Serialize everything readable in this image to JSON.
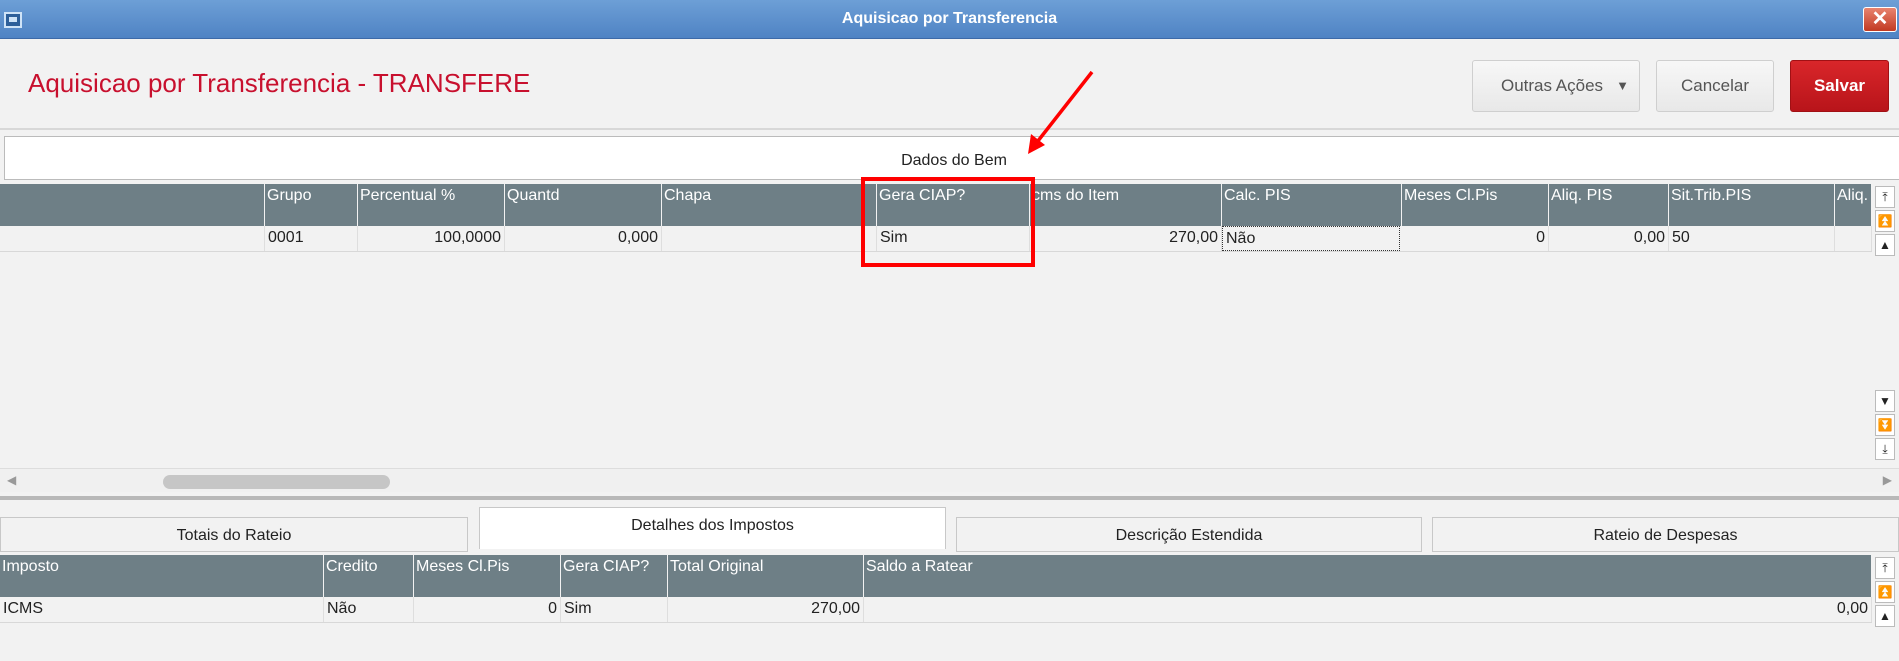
{
  "window": {
    "title": "Aquisicao por Transferencia",
    "close_label": "✕"
  },
  "header": {
    "page_title": "Aquisicao por Transferencia - TRANSFERE",
    "other_actions_label": "Outras Ações",
    "cancel_label": "Cancelar",
    "save_label": "Salvar"
  },
  "section": {
    "title": "Dados do Bem"
  },
  "top_grid": {
    "columns": [
      "Grupo",
      "Percentual %",
      "Quantd",
      "Chapa",
      "Gera CIAP?",
      "cms do Item",
      "Calc. PIS",
      "Meses Cl.Pis",
      "Aliq. PIS",
      "Sit.Trib.PIS",
      "Aliq."
    ],
    "row": [
      "0001",
      "100,0000",
      "0,000",
      "",
      "Sim",
      "270,00",
      "Não",
      "0",
      "0,00",
      "50",
      ""
    ]
  },
  "bottom_tabs": [
    "Totais do Rateio",
    "Detalhes dos Impostos",
    "Descrição Estendida",
    "Rateio de Despesas"
  ],
  "bottom_grid": {
    "columns": [
      "Imposto",
      "Credito",
      "Meses Cl.Pis",
      "Gera CIAP?",
      "Total Original",
      "Saldo a Ratear"
    ],
    "row": [
      "ICMS",
      "Não",
      "0",
      "Sim",
      "270,00",
      "0,00"
    ]
  },
  "icons": {
    "scroll_top": "scroll-top-icon",
    "page_up": "page-up-icon",
    "line_up": "line-up-icon",
    "line_down": "line-down-icon",
    "page_down": "page-down-icon",
    "scroll_bottom": "scroll-bottom-icon"
  },
  "colors": {
    "accent_red": "#c8102e",
    "grid_header": "#6e7f86",
    "titlebar": "#5a8ecc"
  }
}
